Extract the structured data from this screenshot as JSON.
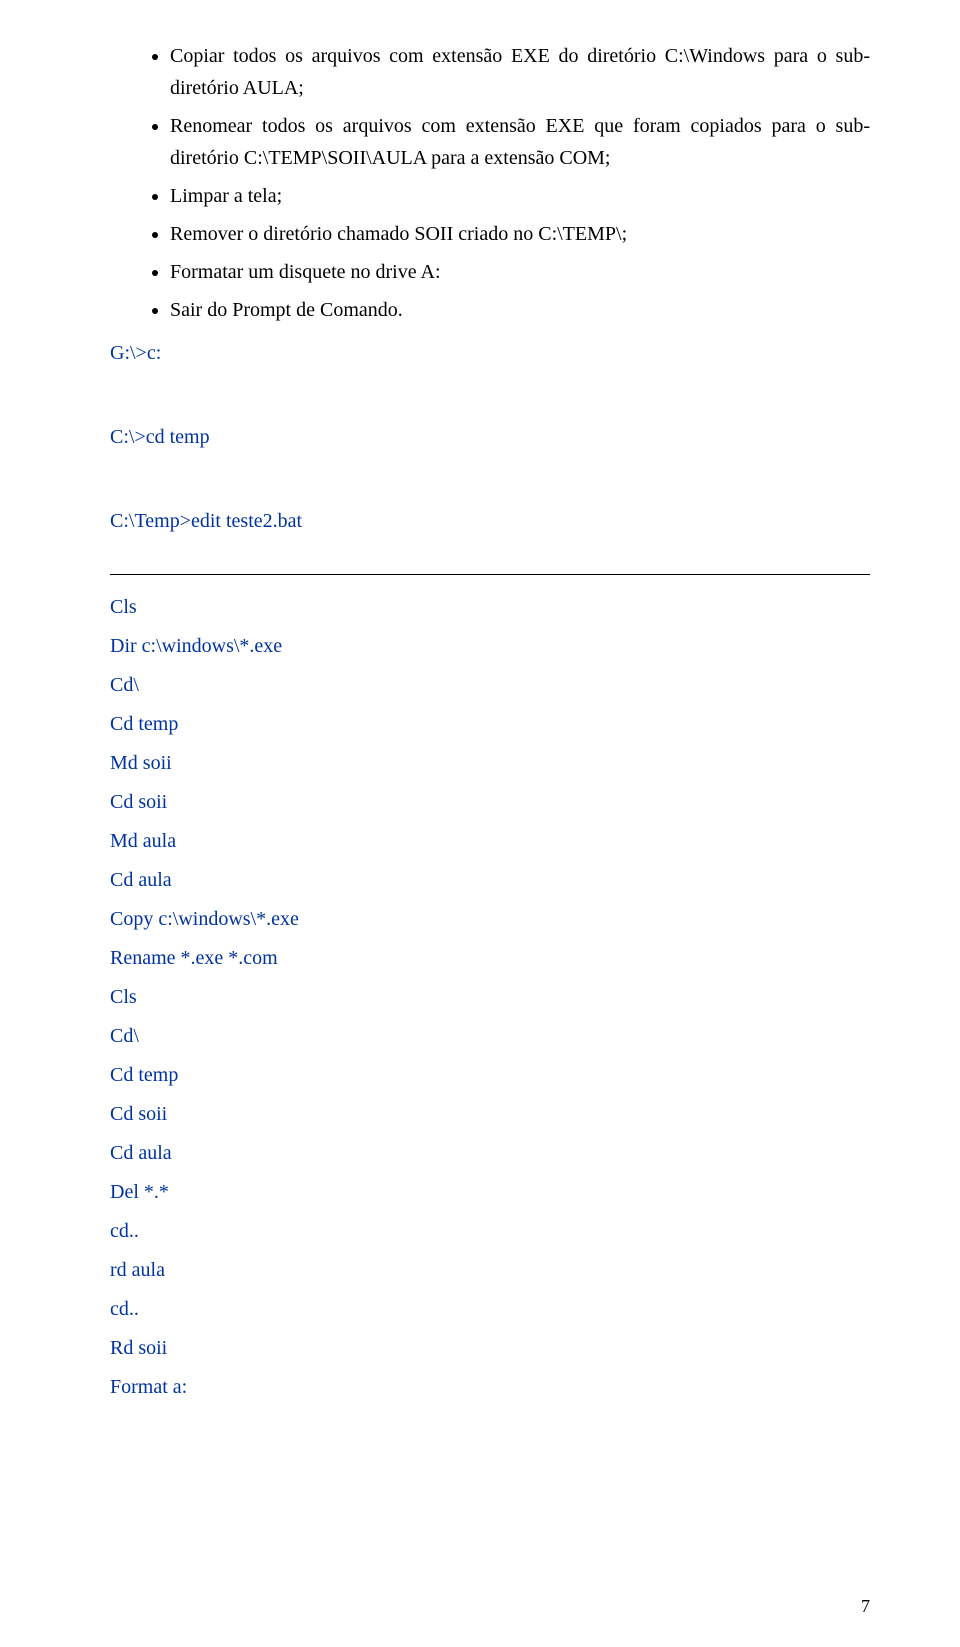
{
  "bullets": [
    "Copiar todos os arquivos com extensão EXE do diretório C:\\Windows para o sub-diretório AULA;",
    "Renomear todos os arquivos com extensão EXE que foram copiados para o sub-diretório C:\\TEMP\\SOII\\AULA para a extensão COM;",
    "Limpar a tela;",
    "Remover o diretório chamado SOII criado no C:\\TEMP\\;",
    "Formatar um disquete no drive A:",
    "Sair do Prompt de Comando."
  ],
  "prompts": {
    "gc": "G:\\>c:",
    "cdtemp": "C:\\>cd temp",
    "editbat": "C:\\Temp>edit teste2.bat"
  },
  "commands": [
    "Cls",
    "Dir c:\\windows\\*.exe",
    "Cd\\",
    "Cd temp",
    "Md soii",
    "Cd soii",
    "Md aula",
    "Cd aula",
    "Copy c:\\windows\\*.exe",
    "Rename *.exe *.com",
    "Cls",
    "Cd\\",
    "Cd temp",
    "Cd soii",
    "Cd aula",
    "Del *.*",
    "cd..",
    "rd aula",
    "cd..",
    "Rd soii",
    "Format a:"
  ],
  "pageNumber": "7"
}
